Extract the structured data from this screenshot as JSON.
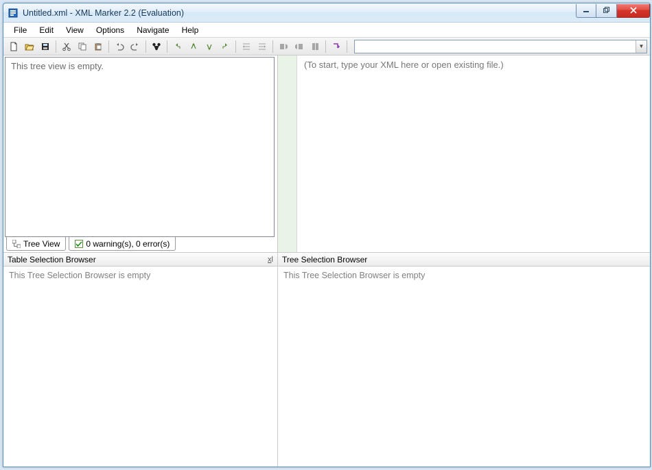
{
  "window": {
    "title": "Untitled.xml - XML Marker 2.2 (Evaluation)"
  },
  "menu": {
    "items": [
      "File",
      "Edit",
      "View",
      "Options",
      "Navigate",
      "Help"
    ]
  },
  "toolbar": {
    "buttons": [
      {
        "name": "new-file-icon"
      },
      {
        "name": "open-file-icon"
      },
      {
        "name": "save-file-icon"
      },
      {
        "sep": true
      },
      {
        "name": "cut-icon"
      },
      {
        "name": "copy-icon"
      },
      {
        "name": "paste-icon"
      },
      {
        "sep": true
      },
      {
        "name": "undo-icon"
      },
      {
        "name": "redo-icon"
      },
      {
        "sep": true
      },
      {
        "name": "find-icon"
      },
      {
        "sep": true
      },
      {
        "name": "nav-back-icon"
      },
      {
        "name": "nav-out-icon"
      },
      {
        "name": "nav-in-icon"
      },
      {
        "name": "nav-forward-icon"
      },
      {
        "sep": true
      },
      {
        "name": "outdent-icon",
        "disabled": true
      },
      {
        "name": "indent-icon",
        "disabled": true
      },
      {
        "sep": true
      },
      {
        "name": "bookmark-prev-icon",
        "disabled": true
      },
      {
        "name": "bookmark-next-icon",
        "disabled": true
      },
      {
        "name": "bookmark-toggle-icon",
        "disabled": true
      },
      {
        "sep": true
      },
      {
        "name": "refresh-icon"
      }
    ]
  },
  "tree": {
    "placeholder": "This tree view is empty.",
    "tabs": {
      "tree_view": "Tree View",
      "errors": "0 warning(s), 0 error(s)"
    }
  },
  "editor": {
    "placeholder": "(To start, type your XML here or open existing file.)"
  },
  "panels": {
    "left": {
      "title": "Table Selection Browser",
      "empty": "This Tree Selection Browser is empty"
    },
    "right": {
      "title": "Tree Selection Browser",
      "empty": "This Tree Selection Browser is empty"
    }
  }
}
